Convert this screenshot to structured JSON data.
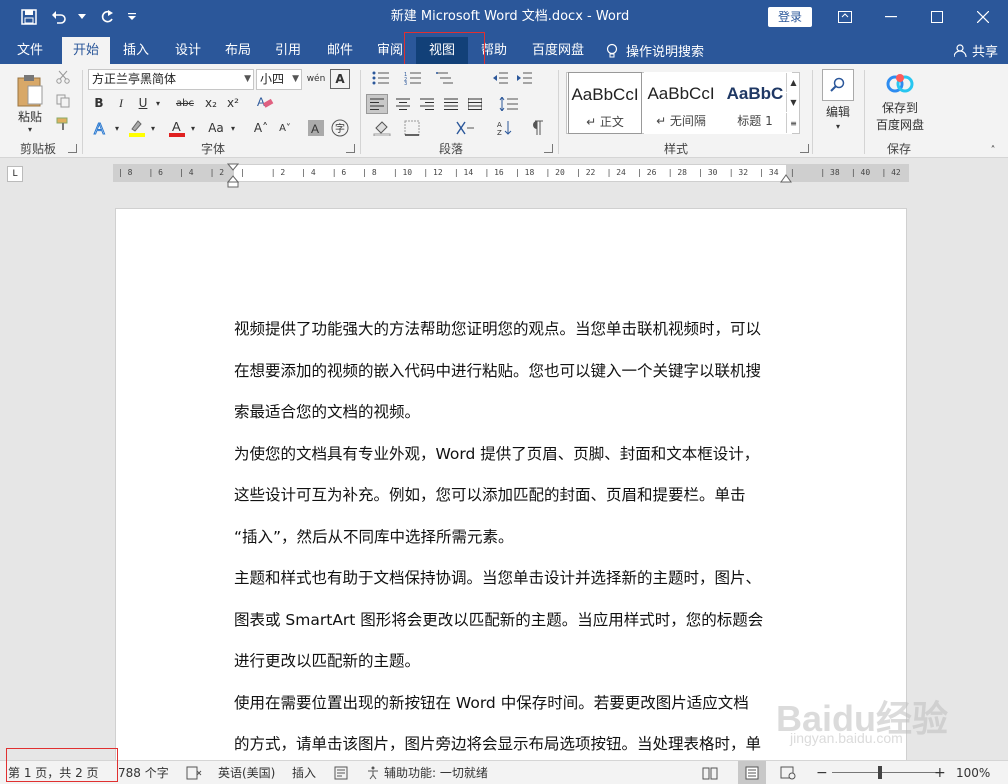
{
  "window": {
    "title": "新建 Microsoft Word 文档.docx  -  Word",
    "login_label": "登录"
  },
  "tabs": [
    {
      "label": "文件"
    },
    {
      "label": "开始"
    },
    {
      "label": "插入"
    },
    {
      "label": "设计"
    },
    {
      "label": "布局"
    },
    {
      "label": "引用"
    },
    {
      "label": "邮件"
    },
    {
      "label": "审阅"
    },
    {
      "label": "视图"
    },
    {
      "label": "帮助"
    },
    {
      "label": "百度网盘"
    }
  ],
  "active_tab": "开始",
  "highlighted_tab": "视图",
  "tell_me": "操作说明搜索",
  "share": "共享",
  "ribbon": {
    "clipboard": {
      "paste": "粘贴",
      "group": "剪贴板"
    },
    "font": {
      "name": "方正兰亭黑简体",
      "size": "小四",
      "group": "字体",
      "bold": "B",
      "italic": "I",
      "underline": "U",
      "strike": "abc",
      "sub": "x₂",
      "sup": "x²",
      "grow": "A˄",
      "shrink": "A˅",
      "case": "Aa",
      "wen": "wén"
    },
    "paragraph": {
      "group": "段落"
    },
    "styles": {
      "group": "样式",
      "items": [
        {
          "sample": "AaBbCcI",
          "name": "↵ 正文"
        },
        {
          "sample": "AaBbCcI",
          "name": "↵ 无间隔"
        },
        {
          "sample": "AaBbC",
          "name": "标题 1"
        }
      ]
    },
    "editing": {
      "label": "编辑"
    },
    "save": {
      "label1": "保存到",
      "label2": "百度网盘",
      "group": "保存"
    }
  },
  "ruler": {
    "ticks": [
      "8",
      "6",
      "4",
      "2",
      "",
      "2",
      "4",
      "6",
      "8",
      "10",
      "12",
      "14",
      "16",
      "18",
      "20",
      "22",
      "24",
      "26",
      "28",
      "30",
      "32",
      "34",
      "",
      "38",
      "40",
      "42"
    ]
  },
  "document": {
    "lines": [
      "视频提供了功能强大的方法帮助您证明您的观点。当您单击联机视频时，可以",
      "在想要添加的视频的嵌入代码中进行粘贴。您也可以键入一个关键字以联机搜",
      "索最适合您的文档的视频。",
      "为使您的文档具有专业外观，Word 提供了页眉、页脚、封面和文本框设计，",
      "这些设计可互为补充。例如，您可以添加匹配的封面、页眉和提要栏。单击",
      "“插入”，然后从不同库中选择所需元素。",
      "主题和样式也有助于文档保持协调。当您单击设计并选择新的主题时，图片、",
      "图表或 SmartArt 图形将会更改以匹配新的主题。当应用样式时，您的标题会",
      "进行更改以匹配新的主题。",
      "使用在需要位置出现的新按钮在 Word 中保存时间。若要更改图片适应文档",
      "的方式，请单击该图片，图片旁边将会显示布局选项按钮。当处理表格时，单"
    ]
  },
  "status": {
    "page": "第 1 页，共 2 页",
    "words": "788 个字",
    "lang": "英语(美国)",
    "mode": "插入",
    "access": "辅助功能: 一切就绪",
    "zoom": "100%",
    "zoom_minus": "−",
    "zoom_plus": "+"
  },
  "watermark": {
    "brand": "Baidu经验",
    "url": "jingyan.baidu.com"
  }
}
